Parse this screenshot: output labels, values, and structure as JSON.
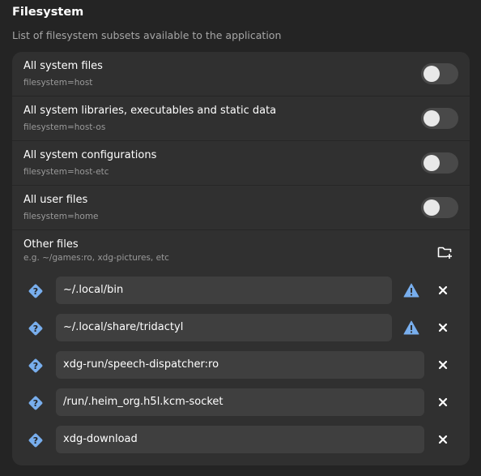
{
  "section": {
    "title": "Filesystem",
    "description": "List of filesystem subsets available to the application"
  },
  "toggles": [
    {
      "title": "All system files",
      "subtitle": "filesystem=host",
      "enabled": false
    },
    {
      "title": "All system libraries, executables and static data",
      "subtitle": "filesystem=host-os",
      "enabled": false
    },
    {
      "title": "All system configurations",
      "subtitle": "filesystem=host-etc",
      "enabled": false
    },
    {
      "title": "All user files",
      "subtitle": "filesystem=home",
      "enabled": false
    }
  ],
  "other_files": {
    "title": "Other files",
    "hint": "e.g. ~/games:ro, xdg-pictures, etc",
    "add_icon": "folder-new-icon",
    "entries": [
      {
        "value": "~/.local/bin",
        "status_icon": "question-icon",
        "warning": true
      },
      {
        "value": "~/.local/share/tridactyl",
        "status_icon": "question-icon",
        "warning": true
      },
      {
        "value": "xdg-run/speech-dispatcher:ro",
        "status_icon": "question-icon",
        "warning": false
      },
      {
        "value": "/run/.heim_org.h5l.kcm-socket",
        "status_icon": "question-icon",
        "warning": false
      },
      {
        "value": "xdg-download",
        "status_icon": "question-icon",
        "warning": false
      }
    ]
  },
  "colors": {
    "background": "#242424",
    "card": "#303030",
    "entry": "#3f3f3f",
    "accent_blue": "#78aeed",
    "switch_off": "#494949"
  }
}
